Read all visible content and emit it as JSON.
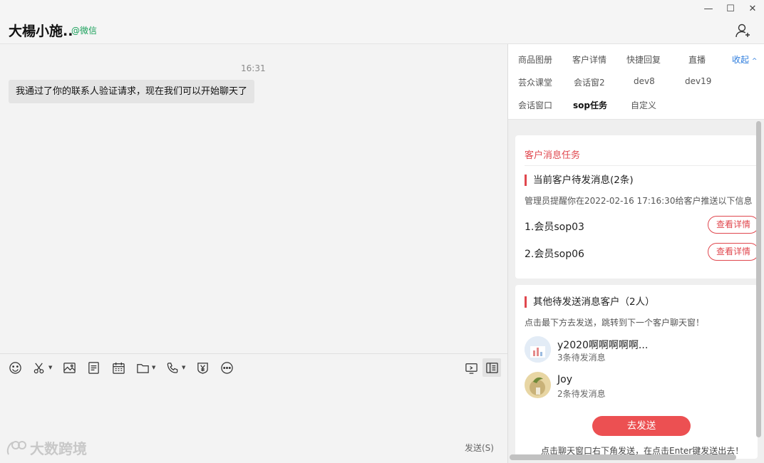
{
  "header": {
    "chat_title": "大楊小施..",
    "chat_source": "@微信",
    "minimize": "—",
    "maximize": "☐",
    "close": "✕"
  },
  "chat": {
    "timestamp": "16:31",
    "message": "我通过了你的联系人验证请求，现在我们可以开始聊天了"
  },
  "toolbar_icons": [
    "emoji-icon",
    "scissors-icon",
    "image-icon",
    "document-icon",
    "calendar-icon",
    "folder-icon",
    "phone-icon",
    "red-packet-icon",
    "more-icon",
    "screen-icon",
    "notes-icon"
  ],
  "input": {
    "send_label": "发送(S)",
    "watermark": "大数跨境"
  },
  "tabs": {
    "t1": "商品图册",
    "t2": "客户详情",
    "t3": "快捷回复",
    "t4": "直播",
    "collapse": "收起",
    "t5": "芸众课堂",
    "t6": "会话窗2",
    "t7": "dev8",
    "t8": "dev19",
    "t9": "会话窗口",
    "t10": "sop任务",
    "t11": "自定义"
  },
  "task_card": {
    "title": "客户消息任务",
    "pending_heading": "当前客户待发消息(2条)",
    "admin_note": "管理员提醒你在2022-02-16 17:16:30给客户推送以下信息",
    "items": [
      {
        "label": "1.会员sop03",
        "button": "查看详情"
      },
      {
        "label": "2.会员sop06",
        "button": "查看详情"
      }
    ]
  },
  "other_card": {
    "heading": "其他待发送消息客户（2人）",
    "note": "点击最下方去发送，跳转到下一个客户聊天窗！",
    "customers": [
      {
        "name": "y2020啊啊啊啊啊...",
        "count": "3条待发消息"
      },
      {
        "name": "Joy",
        "count": "2条待发消息"
      }
    ],
    "send_button": "去发送",
    "bottom_tip": "点击聊天窗口右下角发送，在点击Enter键发送出去！"
  },
  "colors": {
    "accent_red": "#e0474e",
    "wechat_green": "#19a05a",
    "link_blue": "#2d7cdd"
  }
}
